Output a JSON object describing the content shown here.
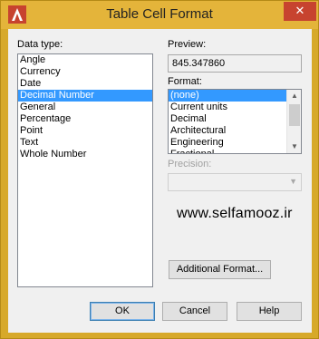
{
  "window": {
    "title": "Table Cell Format",
    "close_glyph": "✕"
  },
  "left": {
    "label": "Data type:",
    "items": [
      "Angle",
      "Currency",
      "Date",
      "Decimal Number",
      "General",
      "Percentage",
      "Point",
      "Text",
      "Whole Number"
    ],
    "selected_index": 3
  },
  "right": {
    "preview_label": "Preview:",
    "preview_value": "845.347860",
    "format_label": "Format:",
    "format_items": [
      "(none)",
      "Current units",
      "Decimal",
      "Architectural",
      "Engineering",
      "Fractional"
    ],
    "format_selected_index": 0,
    "precision_label": "Precision:",
    "precision_value": "",
    "watermark": "www.selfamooz.ir",
    "additional_format_label": "Additional Format..."
  },
  "buttons": {
    "ok": "OK",
    "cancel": "Cancel",
    "help": "Help"
  },
  "colors": {
    "selection": "#3399ff",
    "titlebar": "#e4b43a",
    "close": "#c7432f"
  }
}
